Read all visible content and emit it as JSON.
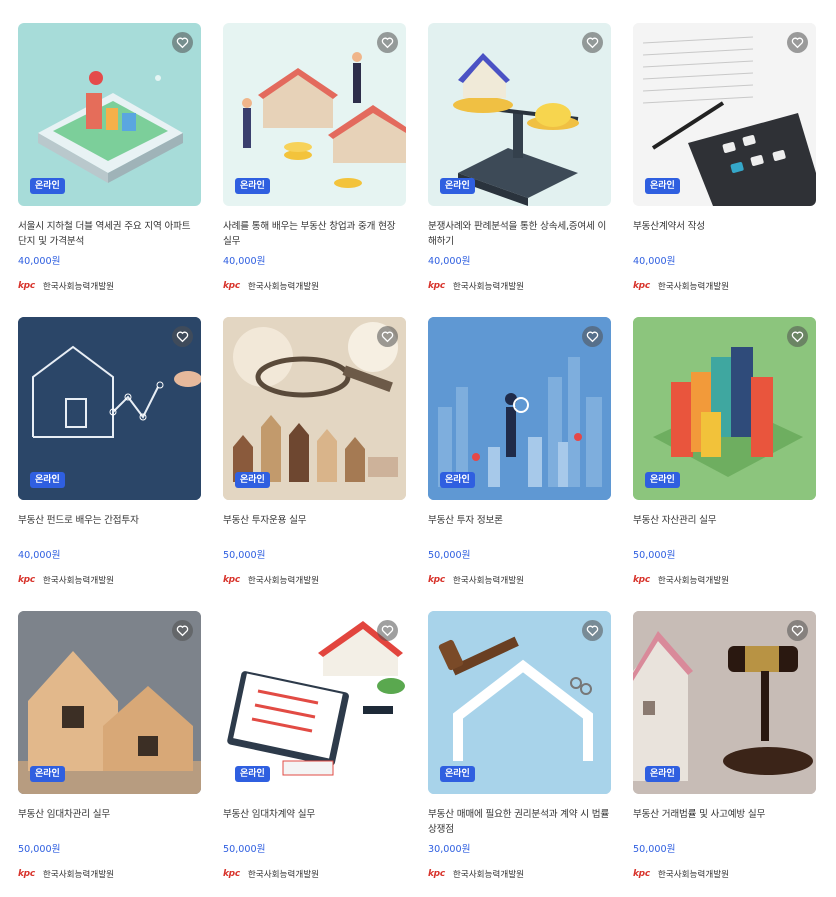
{
  "courses": [
    {
      "badge": "온라인",
      "title": "서울시 지하철 더블 역세권 주요 지역 아파트 단지 및 가격분석",
      "price": "40,000원",
      "org_logo": "kpc",
      "org": "한국사회능력개발원",
      "bg": "#a7dcd9"
    },
    {
      "badge": "온라인",
      "title": "사례를 통해 배우는 부동산 창업과 중개 현장 실무",
      "price": "40,000원",
      "org_logo": "kpc",
      "org": "한국사회능력개발원",
      "bg": "#e6f4f2"
    },
    {
      "badge": "온라인",
      "title": "분쟁사례와 판례분석을 통한 상속세,증여세 이해하기",
      "price": "40,000원",
      "org_logo": "kpc",
      "org": "한국사회능력개발원",
      "bg": "#e2f1f0"
    },
    {
      "badge": "온라인",
      "title": "부동산계약서 작성",
      "price": "40,000원",
      "org_logo": "kpc",
      "org": "한국사회능력개발원",
      "bg": "#eeeeee"
    },
    {
      "badge": "온라인",
      "title": "부동산 펀드로 배우는 간접투자",
      "price": "40,000원",
      "org_logo": "kpc",
      "org": "한국사회능력개발원",
      "bg": "#2e4a6c"
    },
    {
      "badge": "온라인",
      "title": "부동산 투자운용 실무",
      "price": "50,000원",
      "org_logo": "kpc",
      "org": "한국사회능력개발원",
      "bg": "#d9c9b0"
    },
    {
      "badge": "온라인",
      "title": "부동산 투자 정보론",
      "price": "50,000원",
      "org_logo": "kpc",
      "org": "한국사회능력개발원",
      "bg": "#5c93cf"
    },
    {
      "badge": "온라인",
      "title": "부동산 자산관리 실무",
      "price": "50,000원",
      "org_logo": "kpc",
      "org": "한국사회능력개발원",
      "bg": "#8bc47c"
    },
    {
      "badge": "온라인",
      "title": "부동산 임대차관리 실무",
      "price": "50,000원",
      "org_logo": "kpc",
      "org": "한국사회능력개발원",
      "bg": "#8a8f96"
    },
    {
      "badge": "온라인",
      "title": "부동산 임대차계약 실무",
      "price": "50,000원",
      "org_logo": "kpc",
      "org": "한국사회능력개발원",
      "bg": "#ffffff"
    },
    {
      "badge": "온라인",
      "title": "부동산 매매에 필요한 권리분석과 계약 시 법률상쟁점",
      "price": "30,000원",
      "org_logo": "kpc",
      "org": "한국사회능력개발원",
      "bg": "#a9d4ec"
    },
    {
      "badge": "온라인",
      "title": "부동산 거래법률 및 사고예방 실무",
      "price": "50,000원",
      "org_logo": "kpc",
      "org": "한국사회능력개발원",
      "bg": "#b3a6a2"
    }
  ],
  "colors": {
    "accent": "#2f5fe0",
    "logo": "#d8342c"
  },
  "icons": {
    "wishlist": "heart-outline-icon"
  }
}
